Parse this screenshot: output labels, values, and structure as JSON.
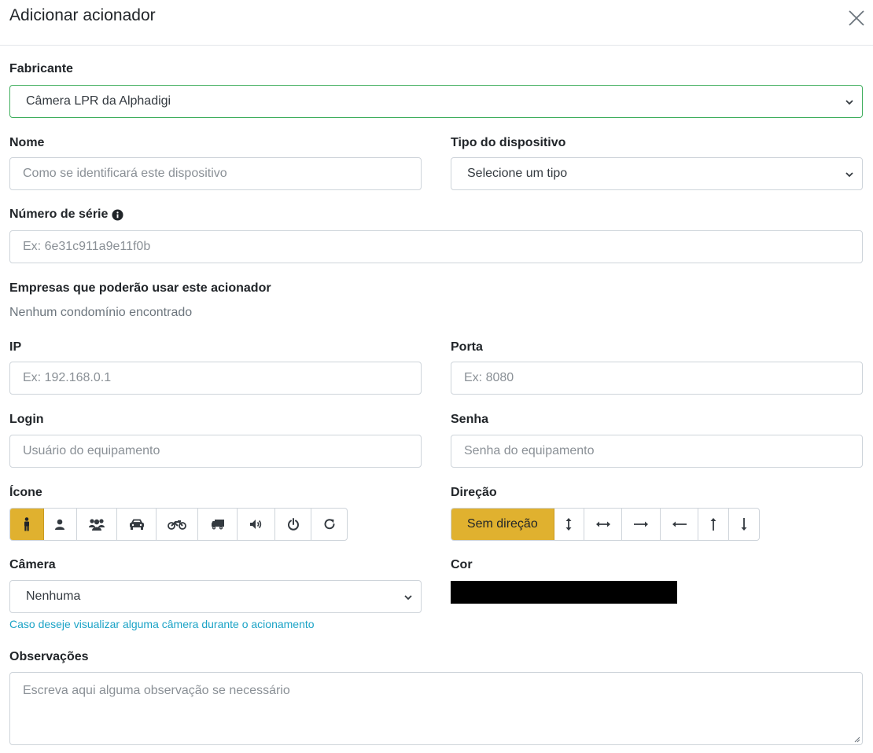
{
  "modal": {
    "title": "Adicionar acionador"
  },
  "fabricante": {
    "label": "Fabricante",
    "value": "Câmera LPR da Alphadigi"
  },
  "nome": {
    "label": "Nome",
    "placeholder": "Como se identificará este dispositivo"
  },
  "tipo": {
    "label": "Tipo do dispositivo",
    "value": "Selecione um tipo"
  },
  "serie": {
    "label": "Número de série",
    "placeholder": "Ex: 6e31c911a9e11f0b"
  },
  "empresas": {
    "label": "Empresas que poderão usar este acionador",
    "empty_text": "Nenhum condomínio encontrado"
  },
  "ip": {
    "label": "IP",
    "placeholder": "Ex: 192.168.0.1"
  },
  "porta": {
    "label": "Porta",
    "placeholder": "Ex: 8080"
  },
  "login": {
    "label": "Login",
    "placeholder": "Usuário do equipamento"
  },
  "senha": {
    "label": "Senha",
    "placeholder": "Senha do equipamento"
  },
  "icone": {
    "label": "Ícone",
    "options": [
      "person-icon",
      "user-icon",
      "users-icon",
      "car-icon",
      "motorcycle-icon",
      "truck-icon",
      "volume-icon",
      "power-icon",
      "refresh-icon"
    ],
    "selected": "person-icon"
  },
  "direcao": {
    "label": "Direção",
    "none_label": "Sem direção",
    "options": [
      "vertical-arrows-icon",
      "horizontal-arrows-icon",
      "arrow-right-icon",
      "arrow-left-icon",
      "arrow-up-icon",
      "arrow-down-icon"
    ],
    "selected": "Sem direção"
  },
  "camera": {
    "label": "Câmera",
    "value": "Nenhuma",
    "help": "Caso deseje visualizar alguma câmera durante o acionamento"
  },
  "cor": {
    "label": "Cor",
    "value": "#000000"
  },
  "observacoes": {
    "label": "Observações",
    "placeholder": "Escreva aqui alguma observação se necessário"
  },
  "colors": {
    "accent": "#e0b12f",
    "focus_border": "#3fae5d",
    "help_text": "#1ba3c6"
  }
}
